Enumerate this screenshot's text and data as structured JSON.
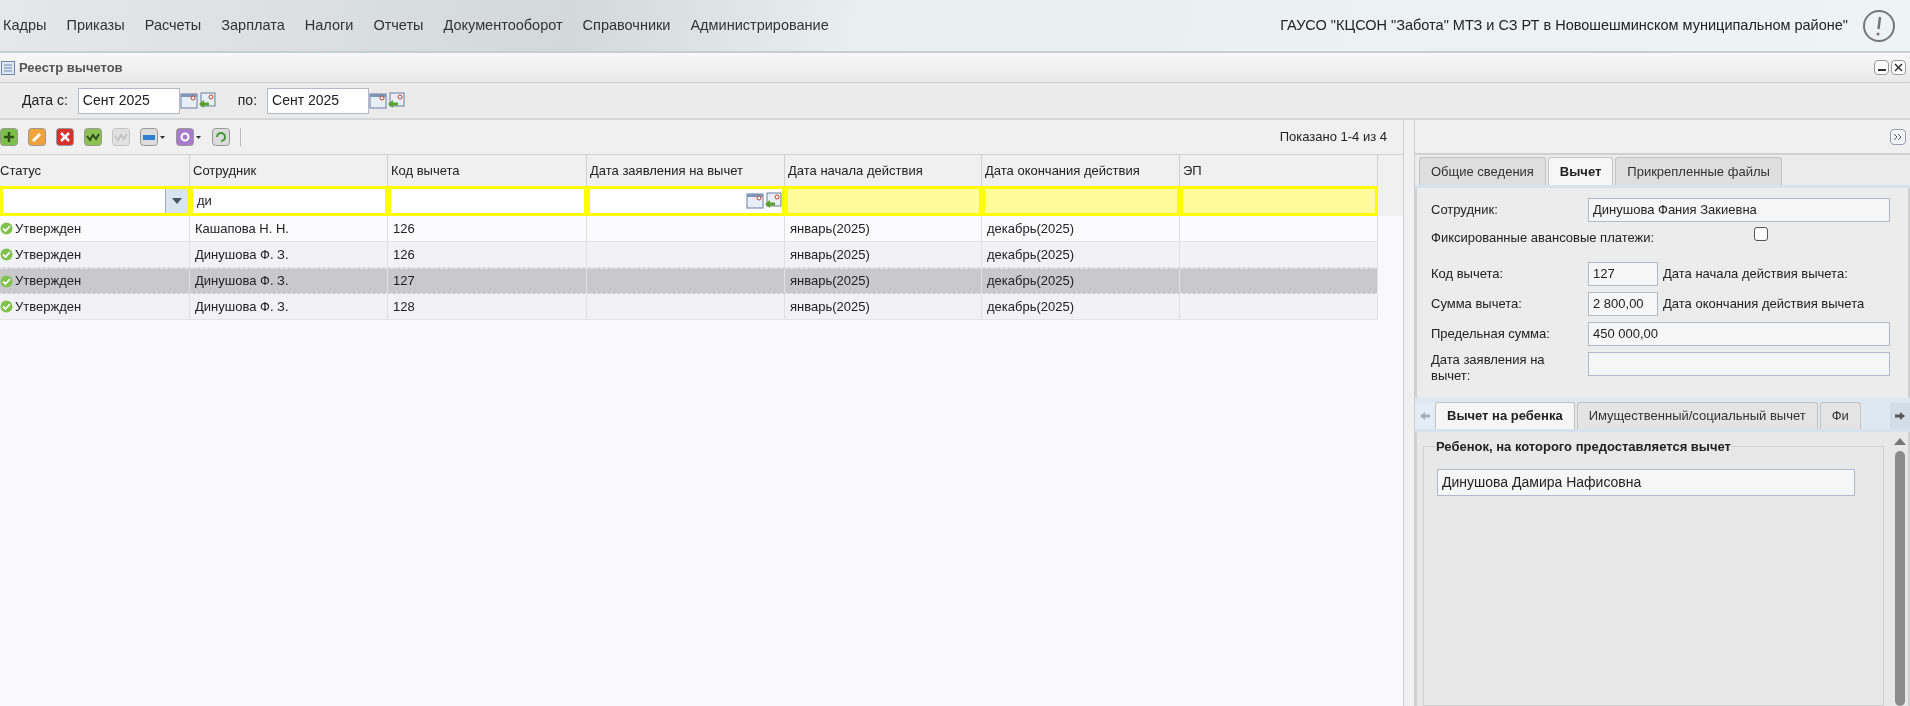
{
  "menu": [
    "Кадры",
    "Приказы",
    "Расчеты",
    "Зарплата",
    "Налоги",
    "Отчеты",
    "Документооборот",
    "Справочники",
    "Администрирование"
  ],
  "organization": "ГАУСО \"КЦСОН \"Забота\" МТЗ и СЗ РТ в Новошешминском муниципальном районе\"",
  "window": {
    "title": "Реестр вычетов"
  },
  "period": {
    "from_label": "Дата с:",
    "from_value": "Сент 2025",
    "to_label": "по:",
    "to_value": "Сент 2025"
  },
  "toolbar": [
    {
      "kind": "add",
      "disabled": false
    },
    {
      "kind": "edit",
      "disabled": false
    },
    {
      "kind": "delete",
      "disabled": false
    },
    {
      "kind": "approve",
      "disabled": false
    },
    {
      "kind": "approve",
      "disabled": true
    },
    {
      "kind": "print",
      "disabled": false
    },
    {
      "kind": "settings",
      "disabled": false
    },
    {
      "kind": "refresh",
      "disabled": false
    }
  ],
  "paging": "Показано 1-4 из 4",
  "table": {
    "columns": [
      "Статус",
      "Сотрудник",
      "Код вычета",
      "Дата заявления на вычет",
      "Дата начала действия",
      "Дата окончания действия",
      "ЭП"
    ],
    "filters": [
      {
        "kind": "combo"
      },
      {
        "kind": "text",
        "value": "ди"
      },
      {
        "kind": "text"
      },
      {
        "kind": "date"
      },
      {
        "kind": "highlighted"
      },
      {
        "kind": "highlighted"
      },
      {
        "kind": "highlighted"
      }
    ],
    "rows": [
      {
        "selected": false,
        "cells": [
          "Утвержден",
          "Кашапова Н. Н.",
          "126",
          "",
          "январь(2025)",
          "декабрь(2025)",
          ""
        ]
      },
      {
        "selected": false,
        "cells": [
          "Утвержден",
          "Динушова Ф. З.",
          "126",
          "",
          "январь(2025)",
          "декабрь(2025)",
          ""
        ]
      },
      {
        "selected": true,
        "cells": [
          "Утвержден",
          "Динушова Ф. З.",
          "127",
          "",
          "январь(2025)",
          "декабрь(2025)",
          ""
        ]
      },
      {
        "selected": false,
        "cells": [
          "Утвержден",
          "Динушова Ф. З.",
          "128",
          "",
          "январь(2025)",
          "декабрь(2025)",
          ""
        ]
      }
    ]
  },
  "details": {
    "tabs": [
      {
        "label": "Общие сведения",
        "selected": false
      },
      {
        "label": "Вычет",
        "selected": true
      },
      {
        "label": "Прикрепленные файлы",
        "selected": false
      }
    ],
    "employee_label": "Сотрудник:",
    "employee": "Динушова Фания Закиевна",
    "fixed_label": "Фиксированные авансовые платежи:",
    "fixed_checked": false,
    "code_label": "Код вычета:",
    "code": "127",
    "start_label": "Дата начала действия вычета:",
    "sum_label": "Сумма вычета:",
    "sum": "2 800,00",
    "end_label": "Дата окончания действия вычета",
    "limit_label": "Предельная сумма:",
    "limit": "450 000,00",
    "application_label": "Дата заявления на вычет:",
    "subtabs": [
      {
        "label": "Вычет на ребенка",
        "selected": true
      },
      {
        "label": "Имущественный/социальный вычет",
        "selected": false
      },
      {
        "label": "Фи",
        "selected": false
      }
    ],
    "child_legend": "Ребенок, на которого предоставляется вычет",
    "child": "Динушова Дамира Нафисовна"
  }
}
